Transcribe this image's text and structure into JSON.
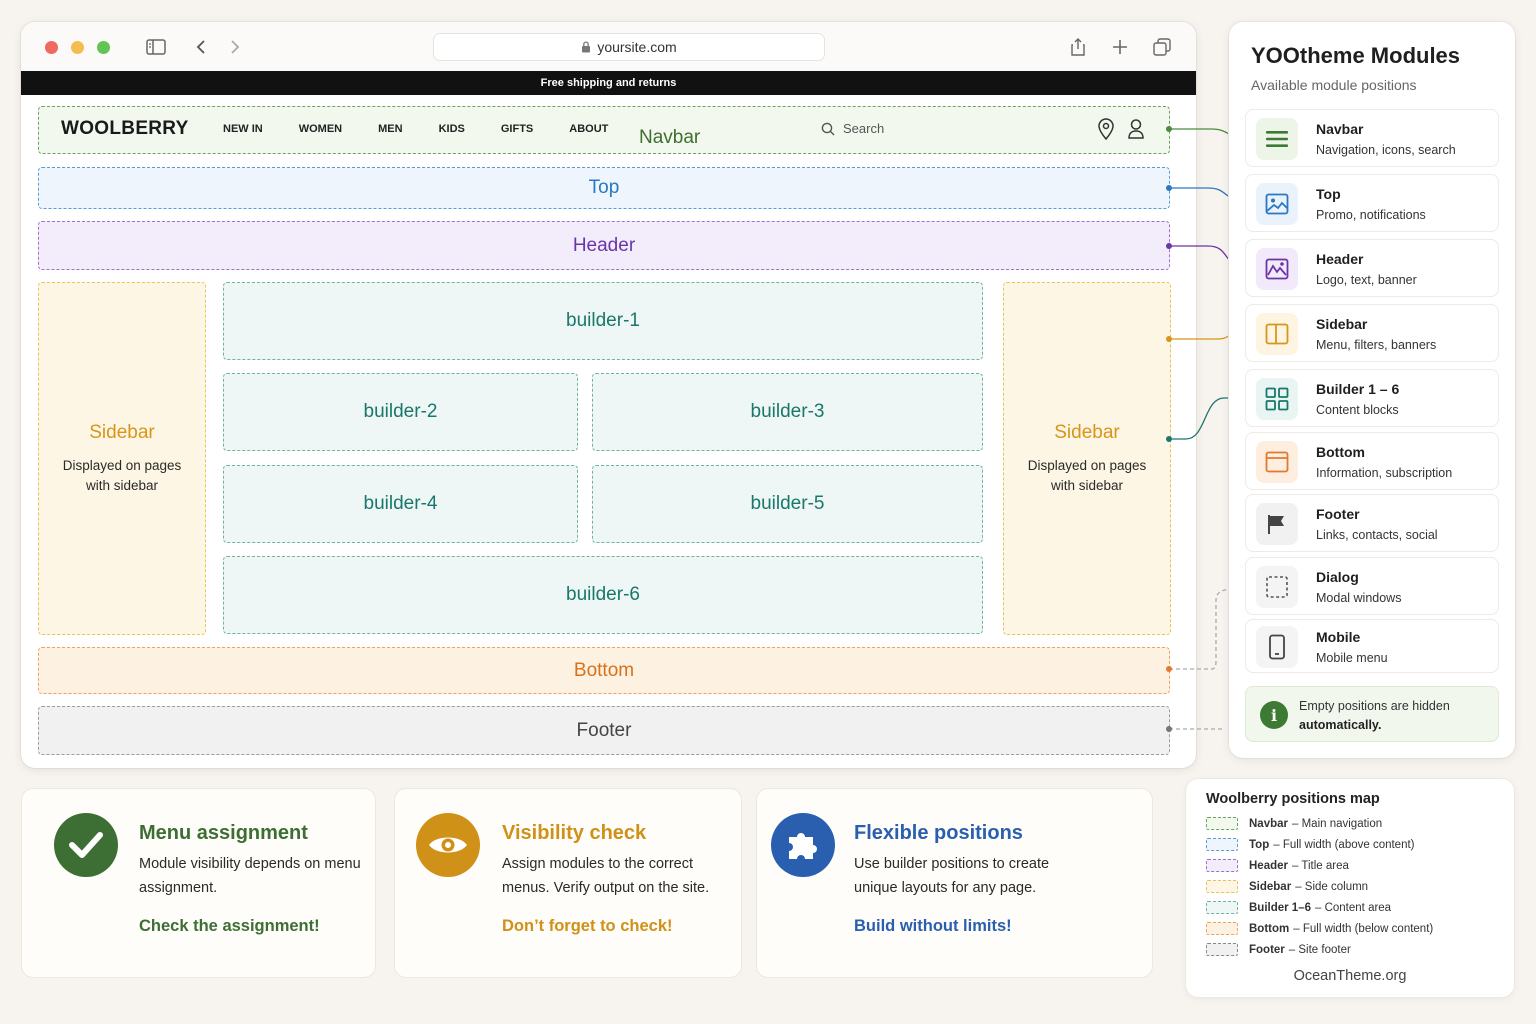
{
  "browser": {
    "url": "yoursite.com",
    "promo_bar": "Free shipping and returns"
  },
  "site": {
    "brand": "WOOLBERRY",
    "nav": [
      "NEW IN",
      "WOMEN",
      "MEN",
      "KIDS",
      "GIFTS",
      "ABOUT"
    ],
    "search_placeholder": "Search"
  },
  "layout": {
    "navbar_label": "Navbar",
    "top_label": "Top",
    "header_label": "Header",
    "sidebar_left": {
      "title": "Sidebar",
      "desc": "Displayed on pages with sidebar"
    },
    "sidebar_right": {
      "title": "Sidebar",
      "desc": "Displayed on pages with sidebar"
    },
    "builders": [
      "builder-1",
      "builder-2",
      "builder-3",
      "builder-4",
      "builder-5",
      "builder-6"
    ],
    "bottom_label": "Bottom",
    "footer_label": "Footer"
  },
  "panel": {
    "title": "YOOtheme Modules",
    "subtitle": "Available module positions",
    "modules": [
      {
        "name": "Navbar",
        "desc": "Navigation, icons, search",
        "icon": "menu-lines-icon",
        "color": "#3d7a33"
      },
      {
        "name": "Top",
        "desc": "Promo, notifications",
        "icon": "image-icon",
        "color": "#2a78c2"
      },
      {
        "name": "Header",
        "desc": "Logo, text, banner",
        "icon": "picture-icon",
        "color": "#6a35a8"
      },
      {
        "name": "Sidebar",
        "desc": "Menu, filters, banners",
        "icon": "columns-icon",
        "color": "#d8951a"
      },
      {
        "name": "Builder 1 – 6",
        "desc": "Content blocks",
        "icon": "grid-icon",
        "color": "#19786b"
      },
      {
        "name": "Bottom",
        "desc": "Information, subscription",
        "icon": "window-icon",
        "color": "#e27a2c"
      },
      {
        "name": "Footer",
        "desc": "Links, contacts, social",
        "icon": "flag-icon",
        "color": "#444444"
      },
      {
        "name": "Dialog",
        "desc": "Modal windows",
        "icon": "dashed-square-icon",
        "color": "#555555"
      },
      {
        "name": "Mobile",
        "desc": "Mobile menu",
        "icon": "phone-icon",
        "color": "#444444"
      }
    ],
    "note_text": "Empty positions are hidden",
    "note_strong": "automatically."
  },
  "cards": [
    {
      "title": "Menu assignment",
      "text": "Module visibility depends on menu assignment.",
      "cta": "Check the assignment!",
      "icon": "check-icon",
      "color": "#3d6f34"
    },
    {
      "title": "Visibility check",
      "text": "Assign modules to the correct menus. Verify output on the site.",
      "cta": "Don’t forget to check!",
      "icon": "eye-icon",
      "color": "#cf9117"
    },
    {
      "title": "Flexible positions",
      "text": "Use builder positions to create unique layouts for any page.",
      "cta": "Build without limits!",
      "icon": "puzzle-icon",
      "color": "#2a5fb0"
    }
  ],
  "map": {
    "title": "Woolberry positions map",
    "rows": [
      {
        "name": "Navbar",
        "desc": "– Main navigation",
        "color": "#6aa45c"
      },
      {
        "name": "Top",
        "desc": "– Full width (above content)",
        "color": "#5b9bd6"
      },
      {
        "name": "Header",
        "desc": "– Title area",
        "color": "#9b72cf"
      },
      {
        "name": "Sidebar",
        "desc": "– Side column",
        "color": "#e8c35b"
      },
      {
        "name": "Builder 1–6",
        "desc": "– Content area",
        "color": "#6fb3a3"
      },
      {
        "name": "Bottom",
        "desc": "– Full width (below content)",
        "color": "#eda35d"
      },
      {
        "name": "Footer",
        "desc": "– Site footer",
        "color": "#888888"
      }
    ],
    "footer": "OceanTheme.org"
  }
}
